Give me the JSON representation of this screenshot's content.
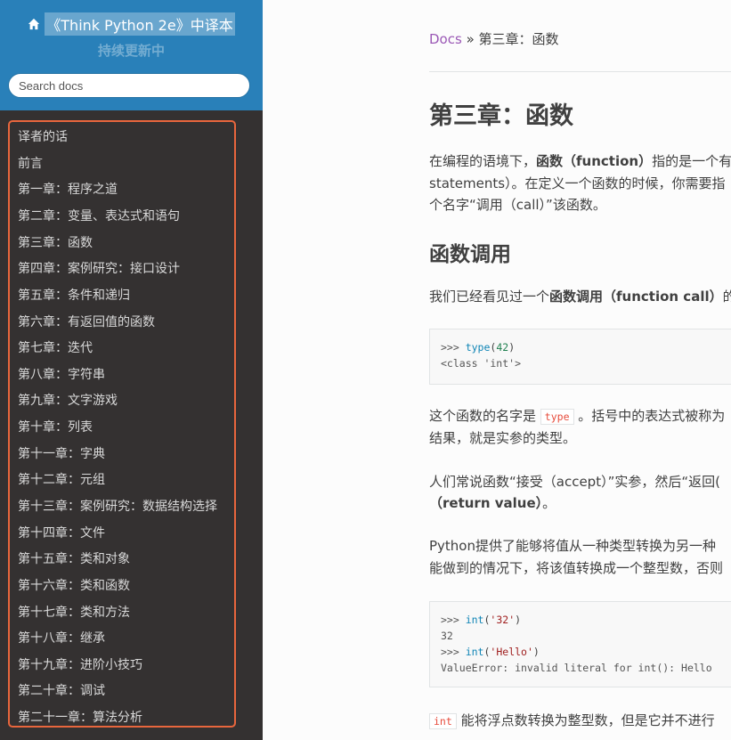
{
  "sidebar": {
    "title": "《Think Python 2e》中译本",
    "subtitle": "持续更新中",
    "search_placeholder": "Search docs",
    "items": [
      "译者的话",
      "前言",
      "第一章：程序之道",
      "第二章：变量、表达式和语句",
      "第三章：函数",
      "第四章：案例研究：接口设计",
      "第五章：条件和递归",
      "第六章：有返回值的函数",
      "第七章：迭代",
      "第八章：字符串",
      "第九章：文字游戏",
      "第十章：列表",
      "第十一章：字典",
      "第十二章：元组",
      "第十三章：案例研究：数据结构选择",
      "第十四章：文件",
      "第十五章：类和对象",
      "第十六章：类和函数",
      "第十七章：类和方法",
      "第十八章：继承",
      "第十九章：进阶小技巧",
      "第二十章：调试",
      "第二十一章：算法分析"
    ]
  },
  "main": {
    "breadcrumb_link": "Docs",
    "breadcrumb_sep": "»",
    "breadcrumb_current": "第三章：函数",
    "h1": "第三章：函数",
    "p1_a": "在编程的语境下，",
    "p1_b": "函数（function）",
    "p1_c": "指的是一个有",
    "p1_line2": "statements）。在定义一个函数的时候，你需要指",
    "p1_line3": "个名字“调用（call）”该函数。",
    "h2": "函数调用",
    "p2_a": "我们已经看见过一个",
    "p2_b": "函数调用（function call）",
    "p2_c": "的",
    "code1": {
      "prompt": ">>> ",
      "fn": "type",
      "open": "(",
      "arg": "42",
      "close": ")",
      "out": "<class 'int'>"
    },
    "p3_a": "这个函数的名字是",
    "p3_code": "type",
    "p3_b": "。括号中的表达式被称为",
    "p3_line2": "结果，就是实参的类型。",
    "p4_line1": "人们常说函数“接受（accept）”实参，然后“返回(",
    "p4_line2": "（return value）",
    "p4_line2_tail": "。",
    "p5_line1": "Python提供了能够将值从一种类型转换为另一种",
    "p5_line2": "能做到的情况下，将该值转换成一个整型数，否则",
    "code2": {
      "prompt": ">>> ",
      "fn": "int",
      "arg1": "'32'",
      "out1": "32",
      "arg2": "'Hello'",
      "out2": "ValueError: invalid literal for int(): Hello"
    },
    "p6_code": "int",
    "p6_text": "能将浮点数转换为整型数，但是它并不进行"
  }
}
